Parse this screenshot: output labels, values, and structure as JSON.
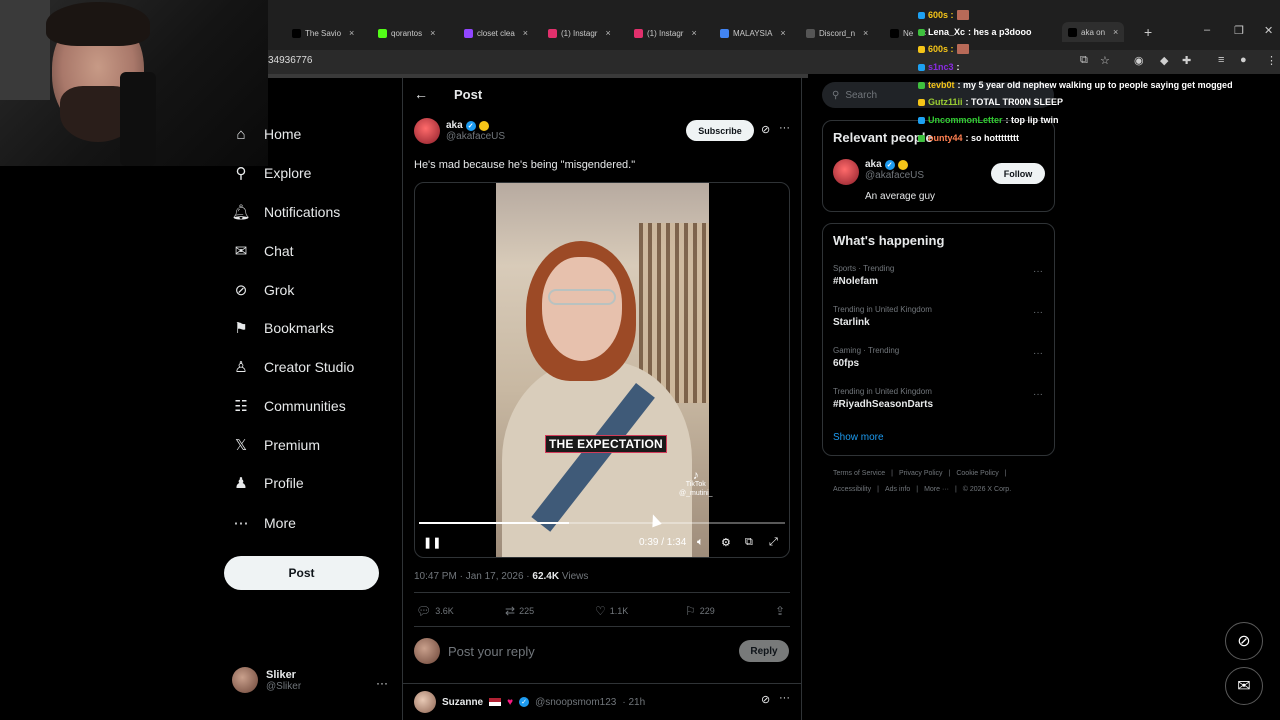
{
  "browser": {
    "tabs": [
      {
        "label": "The Savio",
        "fav_color": "#000000",
        "left": 0
      },
      {
        "label": "qorantos",
        "fav_color": "#53fc18",
        "left": 0
      },
      {
        "label": "closet clea",
        "fav_color": "#9146ff",
        "left": 0
      },
      {
        "label": "(1) Instagr",
        "fav_color": "#e1306c",
        "left": 0
      },
      {
        "label": "(1) Instagr",
        "fav_color": "#e1306c",
        "left": 0
      },
      {
        "label": "MALAYSIA",
        "fav_color": "#4285f4",
        "left": 0
      },
      {
        "label": "Discord_n",
        "fav_color": "#555555",
        "left": 0
      },
      {
        "label": "Ne",
        "fav_color": "#000000",
        "left": 0
      },
      {
        "label": "aka on",
        "fav_color": "#000000",
        "left": 0
      }
    ],
    "address": "34936776"
  },
  "nav": {
    "items": [
      {
        "label": "Home",
        "icon": "home-icon",
        "glyph": "⌂"
      },
      {
        "label": "Explore",
        "icon": "search-icon",
        "glyph": "⚲"
      },
      {
        "label": "Notifications",
        "icon": "bell-icon",
        "glyph": "🔔︎"
      },
      {
        "label": "Chat",
        "icon": "mail-icon",
        "glyph": "✉"
      },
      {
        "label": "Grok",
        "icon": "grok-icon",
        "glyph": "⊘"
      },
      {
        "label": "Bookmarks",
        "icon": "bookmark-icon",
        "glyph": "⚑"
      },
      {
        "label": "Creator Studio",
        "icon": "creator-icon",
        "glyph": "♙"
      },
      {
        "label": "Communities",
        "icon": "communities-icon",
        "glyph": "☷"
      },
      {
        "label": "Premium",
        "icon": "x-logo-icon",
        "glyph": "𝕏"
      },
      {
        "label": "Profile",
        "icon": "profile-icon",
        "glyph": "♟"
      },
      {
        "label": "More",
        "icon": "more-circle-icon",
        "glyph": "⋯"
      }
    ],
    "post_label": "Post",
    "account": {
      "name": "Sliker",
      "handle": "@Sliker"
    }
  },
  "post": {
    "header_title": "Post",
    "author_name": "aka",
    "author_handle": "@akafaceUS",
    "subscribe_label": "Subscribe",
    "text": "He's mad because he's being \"misgendered.\"",
    "video": {
      "caption": "THE EXPECTATION",
      "watermark_brand": "TikTok",
      "watermark_handle": "@_mutini_",
      "time": "0:39 / 1:34",
      "progress": 0.41
    },
    "timestamp": "10:47 PM · Jan 17, 2026 · ",
    "views_count": "62.4K",
    "views_label": " Views",
    "actions": {
      "replies": "3.6K",
      "reposts": "225",
      "likes": "1.1K",
      "bookmarks": "229"
    },
    "reply_placeholder": "Post your reply",
    "reply_label": "Reply"
  },
  "first_reply": {
    "name": "Suzanne",
    "handle": "@snoopsmom123",
    "age": " · 21h"
  },
  "right": {
    "search_placeholder": "Search",
    "relevant_title": "Relevant people",
    "person": {
      "name": "aka",
      "handle": "@akafaceUS",
      "bio": "An average guy",
      "follow_label": "Follow"
    },
    "happening_title": "What's happening",
    "trends": [
      {
        "context": "Sports · Trending",
        "name": "#Nolefam"
      },
      {
        "context": "Trending in United Kingdom",
        "name": "Starlink"
      },
      {
        "context": "Gaming · Trending",
        "name": "60fps"
      },
      {
        "context": "Trending in United Kingdom",
        "name": "#RiyadhSeasonDarts"
      }
    ],
    "show_more": "Show more",
    "footer_row1": [
      "Terms of Service",
      "|",
      "Privacy Policy",
      "|",
      "Cookie Policy",
      "|"
    ],
    "footer_row2": [
      "Accessibility",
      "|",
      "Ads info",
      "|",
      "More ···",
      "|",
      "© 2026 X Corp."
    ]
  },
  "chat": [
    {
      "user": "",
      "msg": "600s :",
      "color": "#f5c518"
    },
    {
      "user": "Lena_Xc",
      "msg": ": hes a p3dooo",
      "color": "#ffffff"
    },
    {
      "user": "",
      "msg": "600s :",
      "color": "#f5c518"
    },
    {
      "user": "s1nc3",
      "msg": ":",
      "color": "#8a2be2"
    },
    {
      "user": "tevb0t",
      "msg": ": my 5 year old nephew walking up to people saying get mogged",
      "color": "#f5c518"
    },
    {
      "user": "Gutz11ii",
      "msg": ": TOTAL TR00N SLEEP",
      "color": "#9acd32"
    },
    {
      "user": "UncommonLetter",
      "msg": ": top lip twin",
      "color": "#32cd32"
    },
    {
      "user": "ounty44",
      "msg": ": so hotttttttt",
      "color": "#ff7f50"
    }
  ]
}
